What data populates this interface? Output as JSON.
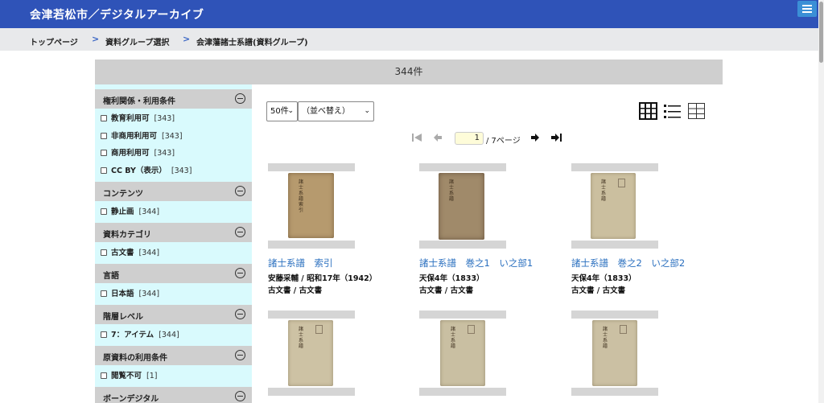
{
  "header": {
    "title": "会津若松市／デジタルアーカイブ",
    "menu_icon": "hamburger-icon"
  },
  "breadcrumb": [
    {
      "label": "トップページ"
    },
    {
      "label": "資料グループ選択"
    },
    {
      "label": "会津藩諸士系譜(資料グループ)"
    }
  ],
  "result_count": "344件",
  "facets": [
    {
      "title": "権利関係・利用条件",
      "items": [
        {
          "name": "教育利用可",
          "count": "[343]"
        },
        {
          "name": "非商用利用可",
          "count": "[343]"
        },
        {
          "name": "商用利用可",
          "count": "[343]"
        },
        {
          "name": "CC BY（表示）",
          "count": "[343]"
        }
      ]
    },
    {
      "title": "コンテンツ",
      "items": [
        {
          "name": "静止画",
          "count": "[344]"
        }
      ]
    },
    {
      "title": "資料カテゴリ",
      "items": [
        {
          "name": "古文書",
          "count": "[344]"
        }
      ]
    },
    {
      "title": "言語",
      "items": [
        {
          "name": "日本語",
          "count": "[344]"
        }
      ]
    },
    {
      "title": "階層レベル",
      "items": [
        {
          "name": "7：アイテム",
          "count": "[344]"
        }
      ]
    },
    {
      "title": "原資料の利用条件",
      "items": [
        {
          "name": "閲覧不可",
          "count": "[1]"
        }
      ]
    },
    {
      "title": "ボーンデジタル",
      "items": []
    }
  ],
  "controls": {
    "per_page": "50件",
    "sort": "（並べ替え）",
    "page_current": "1",
    "page_total": "/ 7ページ",
    "view_modes": [
      "grid-view-icon",
      "list-view-icon",
      "table-view-icon"
    ]
  },
  "items": [
    {
      "title": "諸士系譜　索引",
      "meta1": "安藤采輔 / 昭和17年（1942）",
      "meta2": "古文書 / 古文書",
      "spine": "諸士系譜 索引"
    },
    {
      "title": "諸士系譜　巻之1　い之部1",
      "meta1": "天保4年（1833）",
      "meta2": "古文書 / 古文書",
      "spine": "諸士系譜"
    },
    {
      "title": "諸士系譜　巻之2　い之部2",
      "meta1": "天保4年（1833）",
      "meta2": "古文書 / 古文書",
      "spine": "諸士系譜"
    },
    {
      "title": "",
      "meta1": "",
      "meta2": "",
      "spine": "諸士系譜"
    },
    {
      "title": "",
      "meta1": "",
      "meta2": "",
      "spine": "諸士系譜"
    },
    {
      "title": "",
      "meta1": "",
      "meta2": "",
      "spine": "諸士系譜"
    }
  ],
  "colors": {
    "header": "#2f53b8",
    "sidebar": "#d9fafd",
    "link": "#2a6fbf"
  }
}
